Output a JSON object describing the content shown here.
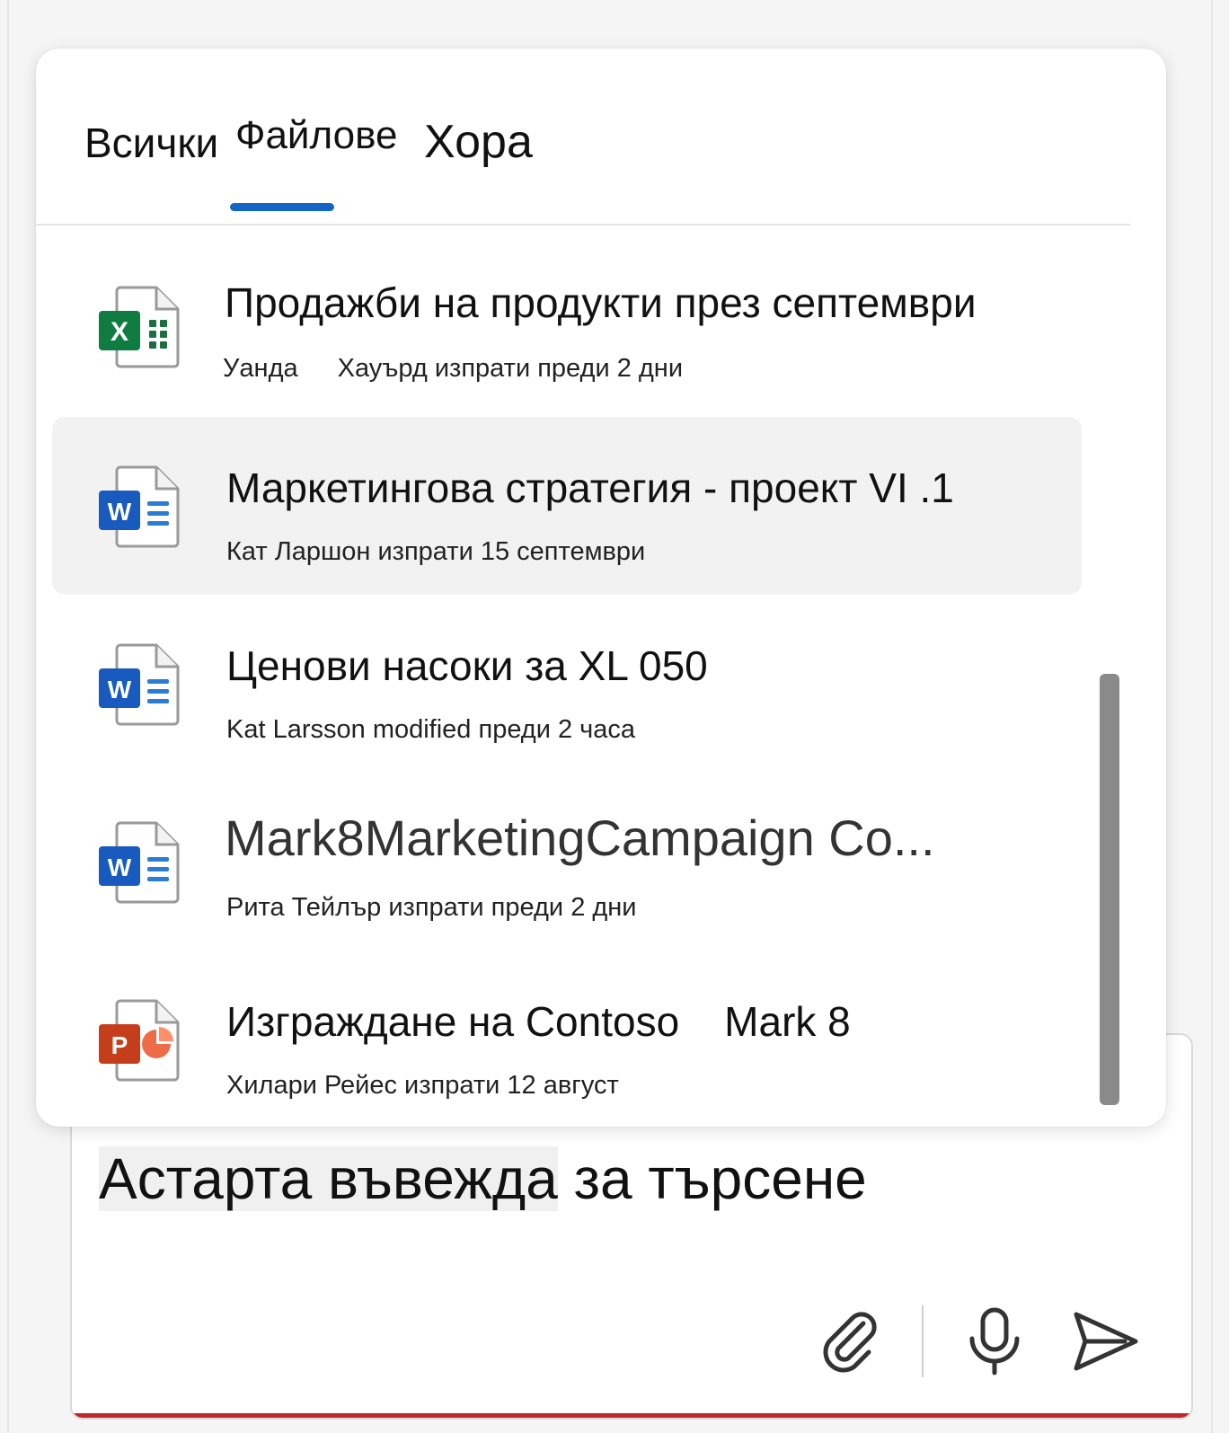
{
  "tabs": [
    {
      "label": "Всички"
    },
    {
      "label": "Файлове"
    },
    {
      "label": "Хора"
    }
  ],
  "files": [
    {
      "type": "excel",
      "title": "Продажби на продукти през септември",
      "meta_a": "Уанда",
      "meta_b": "Хауърд изпрати преди 2 дни"
    },
    {
      "type": "word",
      "title": "Маркетингова стратегия - проект VI .1",
      "meta": "Кат Ларшон изпрати 15 септември"
    },
    {
      "type": "word",
      "title": "Ценови насоки за XL 050",
      "meta": "Kat Larsson modified преди 2 часа"
    },
    {
      "type": "word",
      "title": "Mark8MarketingCampaign Co...",
      "meta": "Рита Тейлър изпрати преди 2 дни"
    },
    {
      "type": "powerpoint",
      "title_a": "Изграждане на Contoso",
      "title_b": "Mark 8",
      "meta": "Хилари Рейес изпрати 12 август"
    }
  ],
  "composer": {
    "text_a": "Астарта въвежда",
    "text_b": " за търсене"
  },
  "icons": {
    "excel": "excel-file-icon",
    "word": "word-file-icon",
    "powerpoint": "powerpoint-file-icon",
    "attach": "paperclip-icon",
    "mic": "microphone-icon",
    "send": "send-icon"
  },
  "colors": {
    "accent": "#1466c6",
    "excel": "#107c41",
    "word": "#185abd",
    "powerpoint": "#c43e1c",
    "composer_underline": "#c4262e"
  }
}
